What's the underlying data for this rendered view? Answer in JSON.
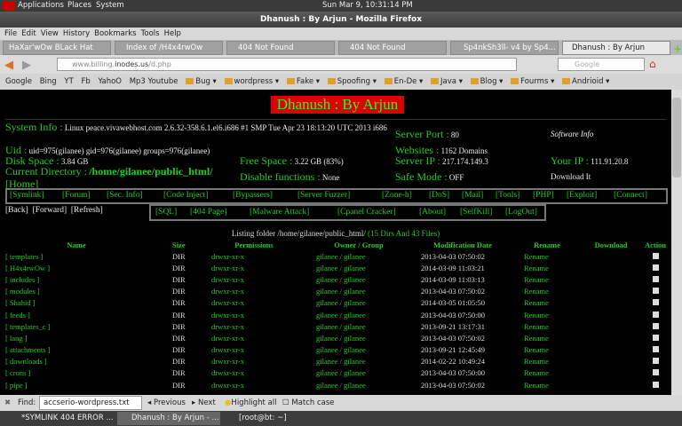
{
  "panel": {
    "applications": "Applications",
    "places": "Places",
    "system": "System",
    "clock": "Sun Mar  9, 10:31:14 PM"
  },
  "window": {
    "title": "Dhanush : By Arjun - Mozilla Firefox"
  },
  "menu": [
    "File",
    "Edit",
    "View",
    "History",
    "Bookmarks",
    "Tools",
    "Help"
  ],
  "tabs": [
    "HaXar'wOw BLack Hat",
    "Index of /H4x4rwOw",
    "404 Not Found",
    "404 Not Found",
    "Sp4nkSh3ll- v4 by Sp4...",
    "Dhanush : By Arjun"
  ],
  "url": {
    "prefix": "www.billing.",
    "host": "inodes.us",
    "path": "/d.php"
  },
  "search_placeholder": "Google",
  "bookmarks": [
    "Google",
    "Bing",
    "YT",
    "Fb",
    "YahoO",
    "Mp3 Youtube",
    "Bug",
    "wordpress",
    "Fake",
    "Spoofing",
    "En-De",
    "Java",
    "Blog",
    "Fourms",
    "Andrioid"
  ],
  "page": {
    "title": "Dhanush : By Arjun",
    "info": {
      "system_label": "System Info :",
      "system": "Linux peace.vivawebhost.com 2.6.32-358.6.1.el6.i686 #1 SMP Tue Apr 23 18:13:20 UTC 2013 i686",
      "uid_label": "Uid :",
      "uid": "uid=975(gilanee) gid=976(gilanee) groups=976(gilanee)",
      "disk_label": "Disk Space :",
      "disk": "3.84 GB",
      "free_label": "Free Space :",
      "free": "3.22 GB (83%)",
      "cwd_label": "Current Directory :",
      "cwd": "/home/gilanee/public_html/",
      "home": "[Home]",
      "disable_label": "Disable functions :",
      "disable": "None",
      "port_label": "Server Port :",
      "port": "80",
      "websites_label": "Websites :",
      "websites": "1162 Domains",
      "ip_label": "Server IP :",
      "ip": "217.174.149.3",
      "safe_label": "Safe Mode :",
      "safe": "OFF",
      "software": "Software Info",
      "yourip_label": "Your IP :",
      "yourip": "111.91.20.8",
      "download": "Download It"
    },
    "nav1": [
      "[Symlink]",
      "[Forum]",
      "[Sec. Info]",
      "[Code Inject]",
      "[Bypassers]",
      "[Server Fuzzer]",
      "[Zone-h]",
      "[DoS]",
      "[Mail]",
      "[Tools]",
      "[PHP]",
      "[Exploit]",
      "[Connect]"
    ],
    "nav2": [
      "[SQL]",
      "[404 Page]",
      "[Malware Attack]",
      "[Cpanel Cracker]",
      "[About]",
      "[SelfKill]",
      "[LogOut]"
    ],
    "history": [
      "[Back]",
      "[Forward]",
      "[Refresh]"
    ],
    "listing": "Listing folder /home/gilanee/public_html/",
    "listing_count": "(15 Dirs And 43 Files)",
    "columns": [
      "Name",
      "Size",
      "Permissions",
      "Owner / Group",
      "Modification Date",
      "Rename",
      "Download",
      "Action"
    ],
    "rows": [
      [
        "[ templates ]",
        "DIR",
        "drwxr-xr-x",
        "gilanee / gilanee",
        "2013-04-03 07:50:02",
        "Rename"
      ],
      [
        "[ H4x4rwOw ]",
        "DIR",
        "drwxr-xr-x",
        "gilanee / gilanee",
        "2014-03-09 11:03:21",
        "Rename"
      ],
      [
        "[ includes ]",
        "DIR",
        "drwxr-xr-x",
        "gilanee / gilanee",
        "2014-03-09 11:03:13",
        "Rename"
      ],
      [
        "[ modules ]",
        "DIR",
        "drwxr-xr-x",
        "gilanee / gilanee",
        "2013-04-03 07:50:02",
        "Rename"
      ],
      [
        "[ Shahid ]",
        "DIR",
        "drwxr-xr-x",
        "gilanee / gilanee",
        "2014-03-05 01:05:50",
        "Rename"
      ],
      [
        "[ feeds ]",
        "DIR",
        "drwxr-xr-x",
        "gilanee / gilanee",
        "2013-04-03 07:50:00",
        "Rename"
      ],
      [
        "[ templates_c ]",
        "DIR",
        "drwxr-xr-x",
        "gilanee / gilanee",
        "2013-09-21 13:17:31",
        "Rename"
      ],
      [
        "[ lang ]",
        "DIR",
        "drwxr-xr-x",
        "gilanee / gilanee",
        "2013-04-03 07:50:02",
        "Rename"
      ],
      [
        "[ attachments ]",
        "DIR",
        "drwxr-xr-x",
        "gilanee / gilanee",
        "2013-09-21 12:45:49",
        "Rename"
      ],
      [
        "[ downloads ]",
        "DIR",
        "drwxr-xr-x",
        "gilanee / gilanee",
        "2014-02-22 10:49:24",
        "Rename"
      ],
      [
        "[ crons ]",
        "DIR",
        "drwxr-xr-x",
        "gilanee / gilanee",
        "2013-04-03 07:50:00",
        "Rename"
      ],
      [
        "[ pipe ]",
        "DIR",
        "drwxr-xr-x",
        "gilanee / gilanee",
        "2013-04-03 07:50:02",
        "Rename"
      ]
    ]
  },
  "find": {
    "label": "Find:",
    "value": "accserio-wordpress.txt",
    "previous": "Previous",
    "next": "Next",
    "highlight": "Highlight all",
    "matchcase": "Match case"
  },
  "taskbar": [
    "*SYMLINK 404 ERROR ...",
    "Dhanush : By Arjun - ...",
    "[root@bt: ~]"
  ]
}
